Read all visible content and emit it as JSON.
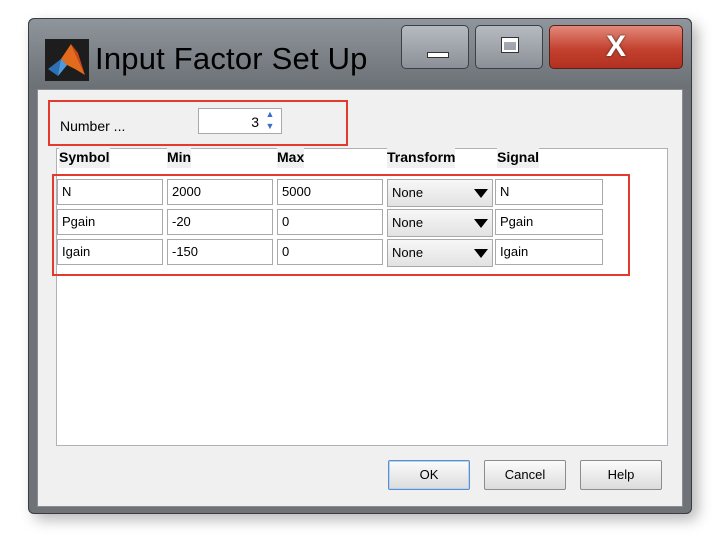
{
  "window": {
    "title": "Input Factor Set Up",
    "icon": "matlab-logo-icon",
    "controls": {
      "minimize": "minimize-icon",
      "maximize": "maximize-icon",
      "close_glyph": "X"
    }
  },
  "number": {
    "label": "Number ...",
    "value": "3"
  },
  "table": {
    "columns": [
      "Symbol",
      "Min",
      "Max",
      "Transform",
      "Signal"
    ],
    "rows": [
      {
        "symbol": "N",
        "min": "2000",
        "max": "5000",
        "transform": "None",
        "signal": "N"
      },
      {
        "symbol": "Pgain",
        "min": "-20",
        "max": "0",
        "transform": "None",
        "signal": "Pgain"
      },
      {
        "symbol": "Igain",
        "min": "-150",
        "max": "0",
        "transform": "None",
        "signal": "Igain"
      }
    ]
  },
  "buttons": {
    "ok": "OK",
    "cancel": "Cancel",
    "help": "Help"
  },
  "colors": {
    "highlight": "#e23a2c",
    "close_button": "#c4412f"
  }
}
